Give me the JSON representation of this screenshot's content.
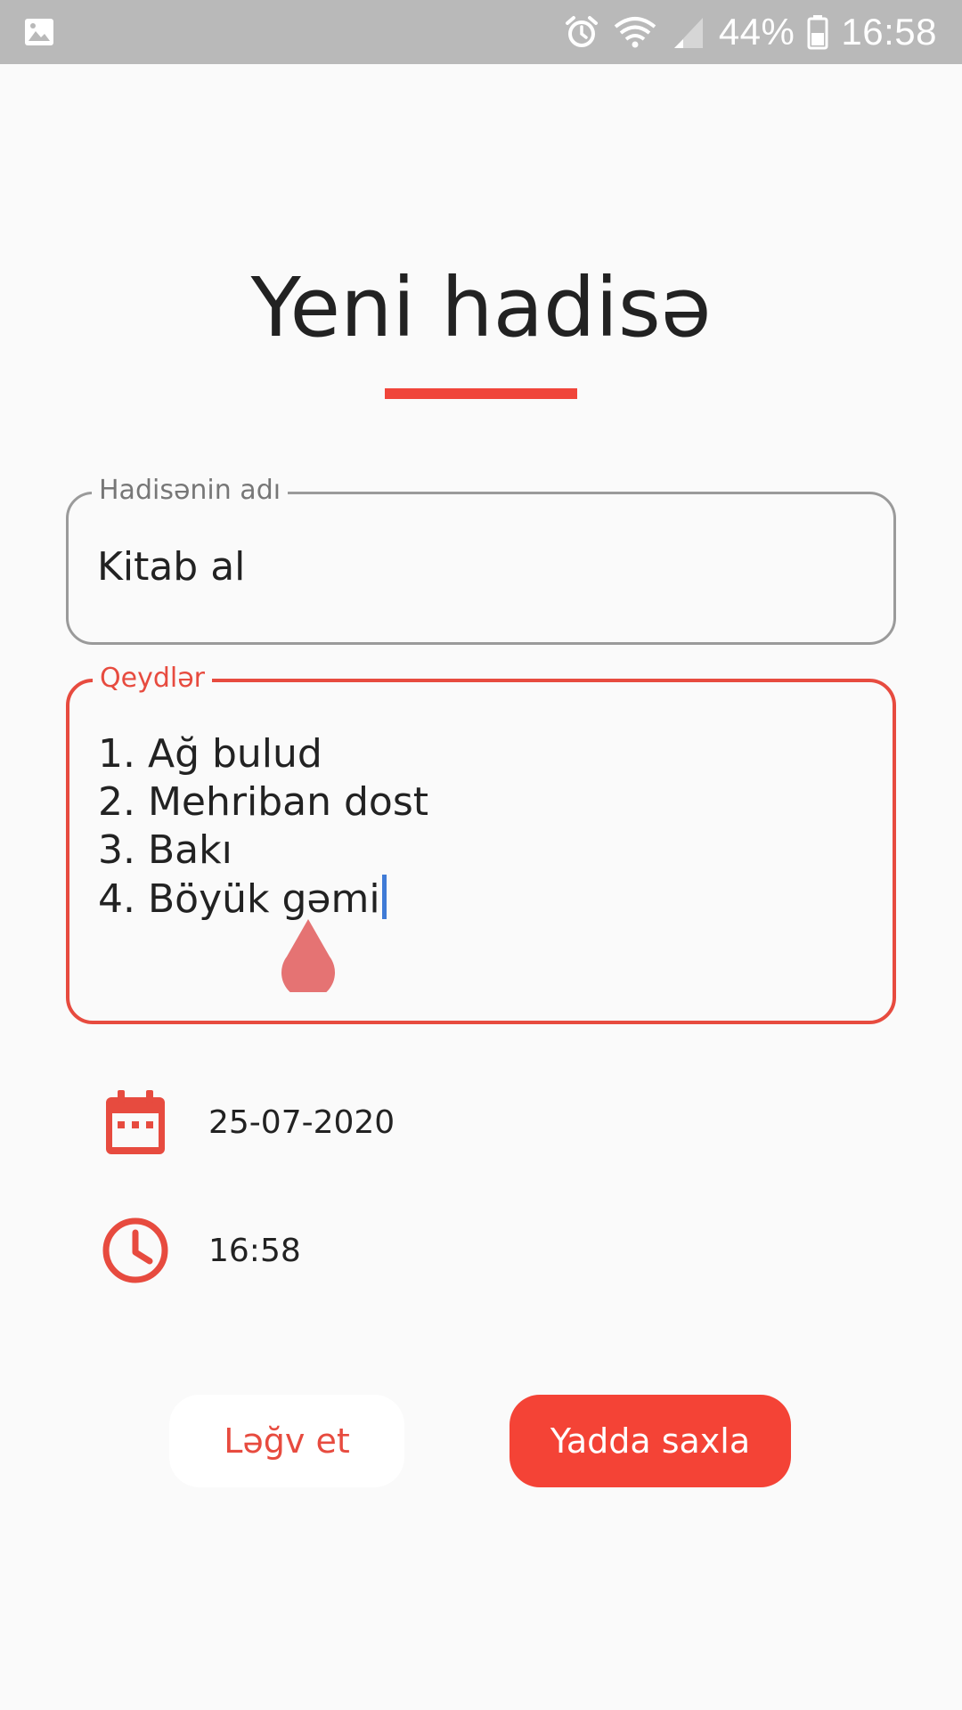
{
  "status_bar": {
    "battery_percent": "44%",
    "time": "16:58",
    "icons": [
      "image-icon",
      "alarm-icon",
      "wifi-icon",
      "signal-icon",
      "battery-icon"
    ]
  },
  "page": {
    "title": "Yeni hadisə"
  },
  "form": {
    "name_field": {
      "label": "Hadisənin adı",
      "value": "Kitab al"
    },
    "notes_field": {
      "label": "Qeydlər",
      "lines": [
        "1. Ağ bulud",
        "2. Mehriban dost",
        "3. Bakı",
        "4. Böyük gəmi"
      ]
    },
    "date": {
      "icon": "calendar-icon",
      "value": "25-07-2020"
    },
    "time": {
      "icon": "clock-icon",
      "value": "16:58"
    }
  },
  "actions": {
    "cancel_label": "Ləğv et",
    "save_label": "Yadda saxla"
  },
  "colors": {
    "accent": "#f44336",
    "outline_inactive": "#9a9a9a",
    "status_bar": "#b9b9b9",
    "background": "#fafafa"
  }
}
